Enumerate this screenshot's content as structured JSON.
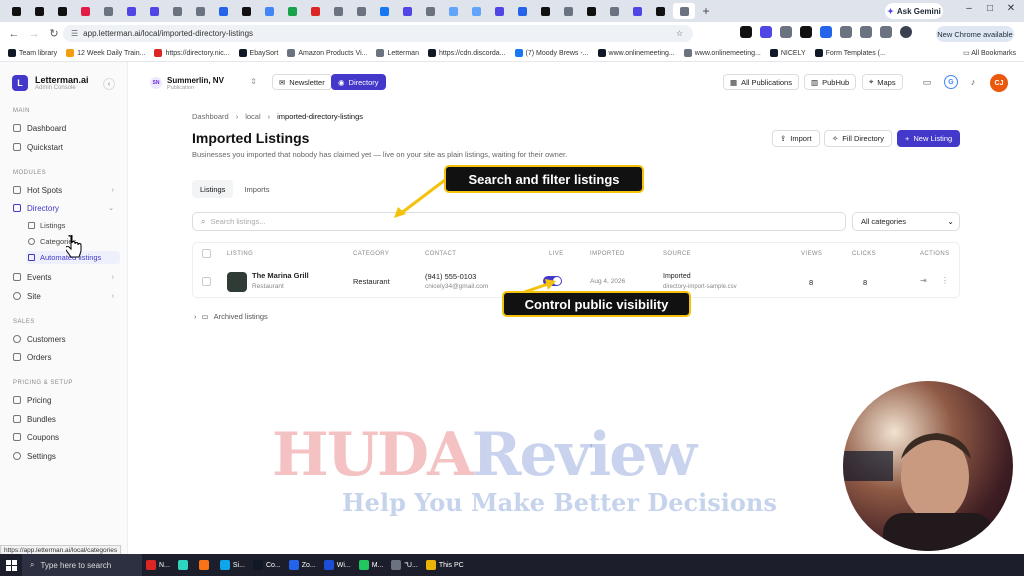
{
  "browser": {
    "url": "app.letterman.ai/local/imported-directory-listings",
    "gemini_label": "Ask Gemini",
    "update_label": "New Chrome available",
    "all_bookmarks": "All Bookmarks",
    "bookmarks": [
      {
        "label": "Team library",
        "color": "#111827"
      },
      {
        "label": "12 Week Daily Train...",
        "color": "#f59e0b"
      },
      {
        "label": "https://directory.nic...",
        "color": "#dc2626"
      },
      {
        "label": "EbaySort",
        "color": "#111827"
      },
      {
        "label": "Amazon Products Vi...",
        "color": "#6b7280"
      },
      {
        "label": "Letterman",
        "color": "#6b7280"
      },
      {
        "label": "https://cdn.discorda...",
        "color": "#111827"
      },
      {
        "label": "(7) Moody Brews -...",
        "color": "#1877f2"
      },
      {
        "label": "www.onlinemeeting...",
        "color": "#111827"
      },
      {
        "label": "www.onlinemeeting...",
        "color": "#6b7280"
      },
      {
        "label": "NICELY",
        "color": "#111827"
      },
      {
        "label": "Form Templates (...",
        "color": "#111827"
      }
    ],
    "tab_favicon_colors": [
      "#111",
      "#111",
      "#111",
      "#e11d48",
      "#6b7280",
      "#4f46e5",
      "#4f46e5",
      "#6b7280",
      "#6b7280",
      "#2563eb",
      "#111",
      "#4285f4",
      "#16a34a",
      "#dc2626",
      "#6b7280",
      "#6b7280",
      "#1877f2",
      "#4f46e5",
      "#6b7280",
      "#60a5fa",
      "#60a5fa",
      "#4f46e5",
      "#2563eb",
      "#111",
      "#6b7280",
      "#111",
      "#6b7280",
      "#4f46e5",
      "#111",
      "#6b7280"
    ]
  },
  "sidebar": {
    "brand_name": "Letterman.ai",
    "brand_sub": "Admin Console",
    "brand_initial": "L",
    "sections": {
      "main": "MAIN",
      "modules": "MODULES",
      "sales": "SALES",
      "pricing": "PRICING & SETUP"
    },
    "items": {
      "dashboard": "Dashboard",
      "quickstart": "Quickstart",
      "hotspots": "Hot Spots",
      "directory": "Directory",
      "listings": "Listings",
      "categories": "Categories",
      "automated": "Automated listings",
      "events": "Events",
      "site": "Site",
      "customers": "Customers",
      "orders": "Orders",
      "pricing": "Pricing",
      "bundles": "Bundles",
      "coupons": "Coupons",
      "settings": "Settings"
    }
  },
  "header": {
    "location_name": "Summerlin, NV",
    "location_sub": "Publication",
    "location_badge": "SN",
    "newsletter": "Newsletter",
    "directory": "Directory",
    "all_publications": "All Publications",
    "pubhub": "PubHub",
    "maps": "Maps",
    "user_initials": "CJ",
    "google_letter": "G"
  },
  "main": {
    "breadcrumb": [
      "Dashboard",
      "local",
      "imported-directory-listings"
    ],
    "title": "Imported Listings",
    "subtitle": "Businesses you imported that nobody has claimed yet — live on your site as plain listings, waiting for their owner.",
    "import": "Import",
    "fill_directory": "Fill Directory",
    "new_listing": "New Listing",
    "tabs": [
      "Listings",
      "Imports"
    ],
    "search_placeholder": "Search listings...",
    "category_filter": "All categories",
    "columns": [
      "LISTING",
      "CATEGORY",
      "CONTACT",
      "LIVE",
      "IMPORTED",
      "SOURCE",
      "VIEWS",
      "CLICKS",
      "ACTIONS"
    ],
    "row": {
      "name": "The Marina Grill",
      "type": "Restaurant",
      "category": "Restaurant",
      "phone": "(941) 555-0103",
      "email": "cnicely34@gmail.com",
      "imported": "Aug 4, 2026",
      "source": "Imported",
      "source_file": "directory-import-sample.csv",
      "views": "8",
      "clicks": "8",
      "live": true
    },
    "archived": "Archived listings"
  },
  "callouts": {
    "search": "Search and filter listings",
    "visibility": "Control public visibility"
  },
  "watermark": {
    "line1a": "HUDA",
    "line1b": "Review",
    "line2": "Help You Make Better Decisions"
  },
  "status_url": "https://app.letterman.ai/local/categories",
  "taskbar": {
    "search": "Type here to search",
    "apps": [
      {
        "label": "N...",
        "color": "#dc2626"
      },
      {
        "label": "",
        "color": "#2dd4bf"
      },
      {
        "label": "",
        "color": "#f97316"
      },
      {
        "label": "Si...",
        "color": "#0ea5e9"
      },
      {
        "label": "Co...",
        "color": "#111827"
      },
      {
        "label": "Zo...",
        "color": "#2563eb"
      },
      {
        "label": "Wi...",
        "color": "#1d4ed8"
      },
      {
        "label": "M...",
        "color": "#22c55e"
      },
      {
        "label": "\"U...",
        "color": "#6b7280"
      },
      {
        "label": "This PC",
        "color": "#eab308"
      }
    ]
  }
}
